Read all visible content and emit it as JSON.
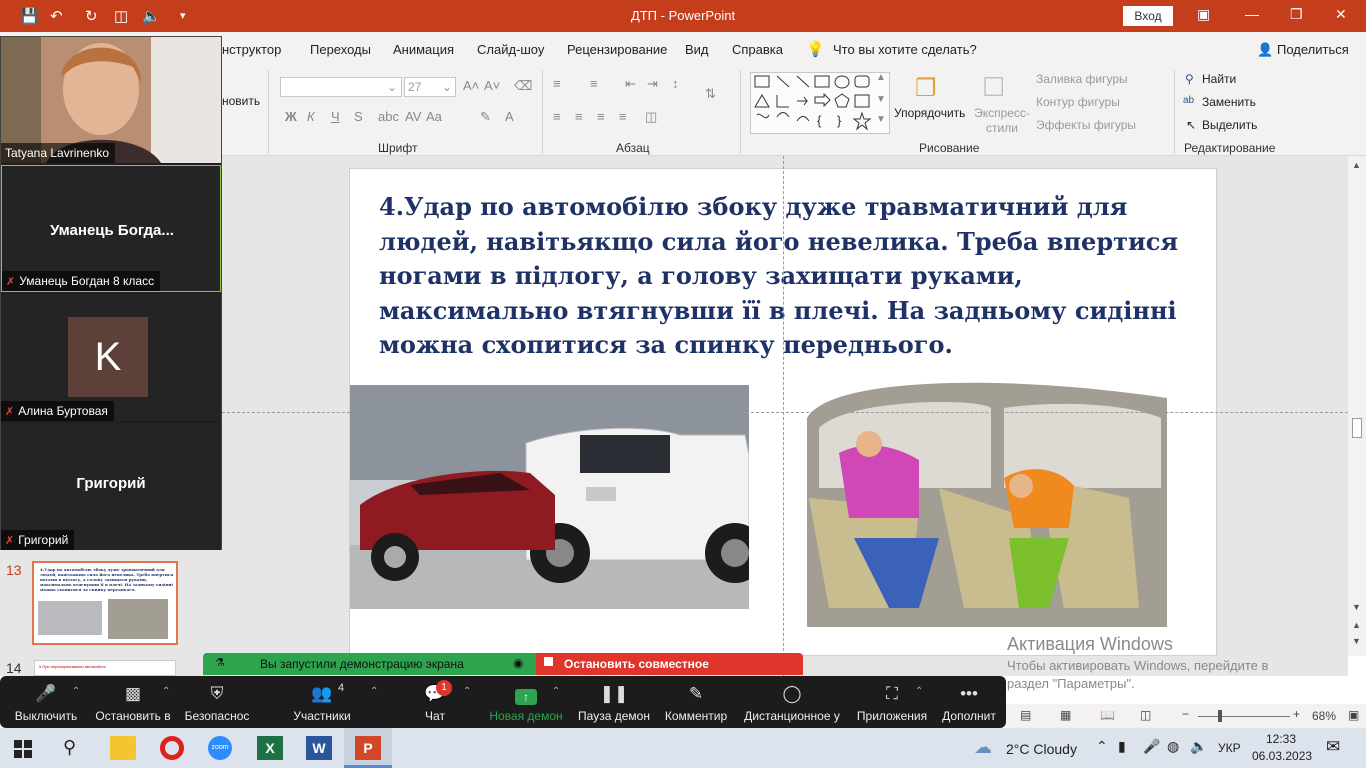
{
  "titlebar": {
    "doc_title": "ДТП - PowerPoint",
    "signin_label": "Вход"
  },
  "tabs": [
    "нструктор",
    "Переходы",
    "Анимация",
    "Слайд-шоу",
    "Рецензирование",
    "Вид",
    "Справка"
  ],
  "tell_me": "Что вы хотите сделать?",
  "share_label": "Поделиться",
  "ribbon": {
    "partial_label": "новить",
    "font_size": "27",
    "group_font": "Шрифт",
    "group_paragraph": "Абзац",
    "group_drawing": "Рисование",
    "group_editing": "Редактирование",
    "arrange_label": "Упорядочить",
    "quick_styles_label": "Экспресс-стили",
    "shape_fill": "Заливка фигуры",
    "shape_outline": "Контур фигуры",
    "shape_effects": "Эффекты фигуры",
    "find": "Найти",
    "replace": "Заменить",
    "select": "Выделить"
  },
  "slide": {
    "text": "4.Удар по автомобілю збоку дуже травматичний для людей, навітьякщо сила його невелика. Треба впертися ногами в підлогу, а голову захищати руками, максимально втягнувши її в плечі. На задньому сидінні можна схопитися за спинку переднього."
  },
  "zoom": {
    "participants": [
      {
        "name": "Tatyana Lavrinenko"
      },
      {
        "name": "Уманець Богдан 8 класс",
        "display": "Уманець  Богда..."
      },
      {
        "name": "Алина Буртовая",
        "initial": "K"
      },
      {
        "name": "Григорий",
        "display": "Григорий"
      }
    ],
    "share_notice": "Вы запустили демонстрацию экрана",
    "stop_share": "Остановить совместное использование",
    "toolbar": [
      {
        "label": "Выключить",
        "icon": "mic-icon"
      },
      {
        "label": "Остановить в",
        "icon": "video-icon"
      },
      {
        "label": "Безопаснос",
        "icon": "shield-icon"
      },
      {
        "label": "Участники",
        "icon": "people-icon",
        "count": "4"
      },
      {
        "label": "Чат",
        "icon": "chat-icon",
        "badge": "1"
      },
      {
        "label": "Новая демон",
        "icon": "share-icon"
      },
      {
        "label": "Пауза демон",
        "icon": "pause-icon"
      },
      {
        "label": "Комментир",
        "icon": "pen-icon"
      },
      {
        "label": "Дистанционное у",
        "icon": "mouse-icon"
      },
      {
        "label": "Приложения",
        "icon": "apps-icon"
      },
      {
        "label": "Дополнит",
        "icon": "more-icon"
      }
    ]
  },
  "thumbs": [
    {
      "number": "13",
      "text": "4.Удар по автомобілю збоку дуже травматичний для людей, навітьякщо сила його невелика. Треба впертися ногами в підлогу, а голову захищати руками, максимально втягнувши її в плечі. На задньому сидінні можна схопитися за спинку переднього."
    },
    {
      "number": "14",
      "text": "5.При переворачивании автомобіля"
    }
  ],
  "activation": {
    "title": "Активация Windows",
    "line1": "Чтобы активировать Windows, перейдите в",
    "line2": "раздел \"Параметры\"."
  },
  "status": {
    "zoom": "68%"
  },
  "taskbar": {
    "weather": "2°C  Cloudy",
    "lang": "УКР",
    "time": "12:33",
    "date": "06.03.2023"
  },
  "colors": {
    "accent": "#c43e1c",
    "slide_text": "#1f3265",
    "zoom_green": "#2ea44f",
    "zoom_red": "#e0352b"
  }
}
